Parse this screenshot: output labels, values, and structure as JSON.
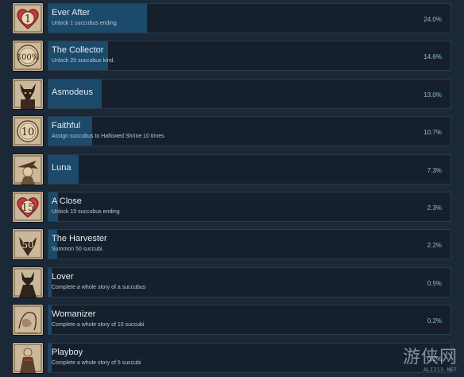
{
  "achievements": [
    {
      "title": "Ever After",
      "desc": "Unlock 1 succubus ending",
      "percent_label": "24.0%",
      "percent": 24.0,
      "icon": "heart-number-icon",
      "icon_text": "1"
    },
    {
      "title": "The Collector",
      "desc": "Unlock 20 succubus kind.",
      "percent_label": "14.6%",
      "percent": 14.6,
      "icon": "badge-number-icon",
      "icon_text": "100%"
    },
    {
      "title": "Asmodeus",
      "desc": "",
      "percent_label": "13.0%",
      "percent": 13.0,
      "icon": "demon-portrait-icon",
      "icon_text": ""
    },
    {
      "title": "Faithful",
      "desc": "Assign succubus to Hallowed Shrine 10 times",
      "percent_label": "10.7%",
      "percent": 10.7,
      "icon": "badge-number-icon",
      "icon_text": "10"
    },
    {
      "title": "Luna",
      "desc": "",
      "percent_label": "7.3%",
      "percent": 7.3,
      "icon": "witch-portrait-icon",
      "icon_text": ""
    },
    {
      "title": "A Close",
      "desc": "Unlock 15 succubus ending",
      "percent_label": "2.3%",
      "percent": 2.3,
      "icon": "heart-number-icon",
      "icon_text": "15"
    },
    {
      "title": "The Harvester",
      "desc": "Summon 50 succubi.",
      "percent_label": "2.2%",
      "percent": 2.2,
      "icon": "horned-number-icon",
      "icon_text": "50"
    },
    {
      "title": "Lover",
      "desc": "Complete a whole story of a succubus",
      "percent_label": "0.5%",
      "percent": 0.5,
      "icon": "horned-figure-icon",
      "icon_text": ""
    },
    {
      "title": "Womanizer",
      "desc": "Complete a whole story of 10 succubi",
      "percent_label": "0.2%",
      "percent": 0.2,
      "icon": "sketch-figure-icon",
      "icon_text": ""
    },
    {
      "title": "Playboy",
      "desc": "Complete a whole story of 5 succubi",
      "percent_label": "0.2%",
      "percent": 0.2,
      "icon": "robed-figure-icon",
      "icon_text": ""
    }
  ],
  "watermark": {
    "text": "游侠网",
    "sub": "ALI213.NET"
  },
  "colors": {
    "background": "#1b2838",
    "panel": "#16202d",
    "bar": "#1b4a6b",
    "percent_text": "#8fbde0",
    "heart": "#c63a37"
  }
}
